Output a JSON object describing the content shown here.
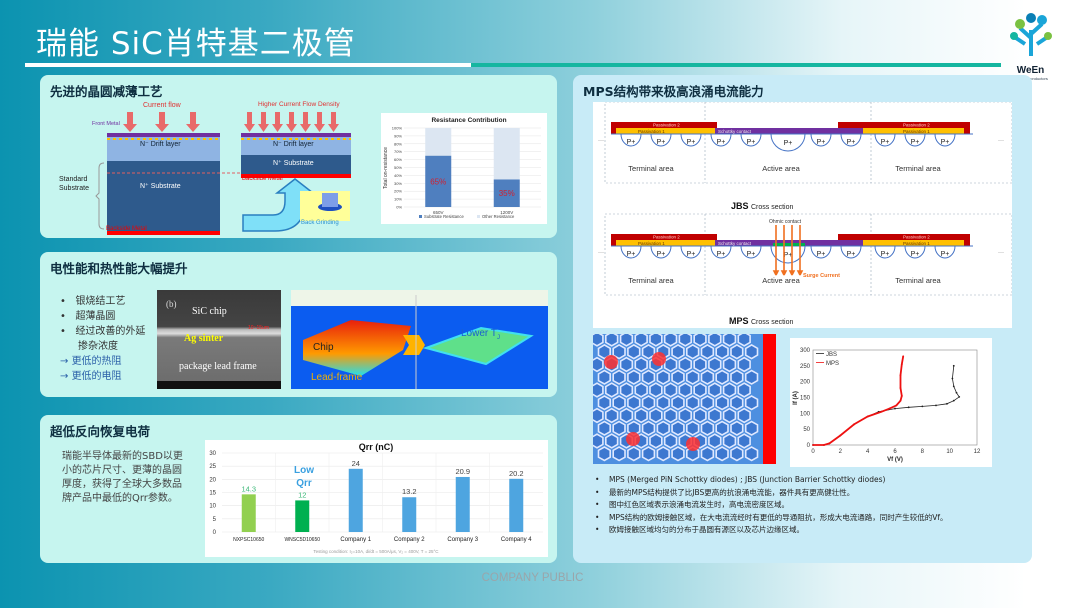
{
  "header": {
    "title": "瑞能 SiC肖特基二极管",
    "logo_text": "WeEn",
    "logo_sub": "En Semiconductors"
  },
  "panels": {
    "wafer": {
      "title": "先进的晶圆减薄工艺",
      "left_diagram": {
        "current_flow": "Current flow",
        "front_metal": "Front Metal",
        "drift": "N⁻ Drift layer",
        "substrate": "N⁺ Substrate",
        "backside": "Backside Metal",
        "standard": "Standard",
        "substrate_label": "Substrate"
      },
      "right_diagram": {
        "higher": "Higher Current Flow Density",
        "drift": "N⁻ Drift layer",
        "substrate": "N⁺ Substrate",
        "backside": "Backside Metal",
        "grinding": "Back Grinding"
      }
    },
    "performance": {
      "title": "电性能和热性能大幅提升",
      "bullets": [
        "银烧结工艺",
        "超薄晶圆",
        "经过改善的外延",
        "掺杂浓度"
      ],
      "arrows": [
        "更低的热阻",
        "更低的电阻"
      ],
      "sem": {
        "tag": "(b)",
        "chip": "SiC chip",
        "thickness": "10~15um",
        "sinter": "Ag sinter",
        "frame": "package lead frame"
      },
      "thermal": {
        "chip": "Chip",
        "frame": "Lead-frame",
        "lower": "Lower T",
        "lower_sub": "J"
      }
    },
    "qrr": {
      "title": "超低反向恢复电荷",
      "text": "瑞能半导体最新的SBD以更小的芯片尺寸、更薄的晶圆厚度，获得了全球大多数品牌产品中最低的Qrr参数。",
      "annotation": "Low Qrr",
      "condition": "Testing condition: I₂=10A, di/dt = 500A/μs, V₂ = 400V, T = 25°C"
    },
    "mps": {
      "title": "MPS结构带来极高浪涌电流能力",
      "cross": {
        "passivation2": "Passivation 2",
        "passivation1": "Passivation 1",
        "schottky": "Schottky contact",
        "pplus": "P+",
        "terminal": "Terminal area",
        "active": "Active area",
        "ohmic": "Ohmic contact",
        "surge": "Surge Current",
        "dots": "···"
      },
      "jbs_caption": {
        "bold": "JBS",
        "rest": "Cross section"
      },
      "mps_caption": {
        "bold": "MPS",
        "rest": "Cross section"
      },
      "bullets": [
        "MPS (Merged PiN Schottky diodes) ; JBS (Junction Barrier Schottky diodes)",
        "最新的MPS结构提供了比JBS更高的抗浪涌电流能，器件具有更高健壮性。",
        "图中红色区域表示浪涌电流发生时，高电流密度区域。",
        "MPS结构的欧姆接触区域，在大电流流经时有更低的导通阻抗，形成大电流通路，同时产生较低的Vf。",
        "欧姆接触区域均匀的分布于晶圆有源区以及芯片边缘区域。"
      ]
    }
  },
  "footer": {
    "label": "COMPANY PUBLIC"
  },
  "chart_data": [
    {
      "type": "bar",
      "stacked": true,
      "title": "Resistance Contribution",
      "ylabel": "Total on-resistance",
      "categories": [
        "650V",
        "1200V"
      ],
      "yticks": [
        "0%",
        "10%",
        "20%",
        "30%",
        "40%",
        "50%",
        "60%",
        "70%",
        "80%",
        "90%",
        "100%"
      ],
      "ylim": [
        0,
        100
      ],
      "series": [
        {
          "name": "Substrate Resistance",
          "values": [
            65,
            35
          ],
          "labels": [
            "65%",
            "35%"
          ],
          "color": "#4f7fbf"
        },
        {
          "name": "Other Resistance",
          "values": [
            35,
            65
          ],
          "color": "#dce6f2"
        }
      ],
      "legend": "bottom"
    },
    {
      "type": "bar",
      "title": "Qrr (nC)",
      "categories": [
        "NXPSC10650",
        "WNSC5D10650",
        "Company 1",
        "Company 2",
        "Company 3",
        "Company 4"
      ],
      "values": [
        14.3,
        12,
        24,
        13.2,
        20.9,
        20.2
      ],
      "labels": [
        "14.3",
        "12",
        "24",
        "13.2",
        "20.9",
        "20.2"
      ],
      "colors": [
        "#92d050",
        "#00b050",
        "#4ea5e0",
        "#4ea5e0",
        "#4ea5e0",
        "#4ea5e0"
      ],
      "yticks": [
        "0",
        "5",
        "10",
        "15",
        "20",
        "25",
        "30"
      ],
      "ylim": [
        0,
        30
      ],
      "grid": true
    },
    {
      "type": "line",
      "xlabel": "Vf (V)",
      "ylabel": "If (A)",
      "xlim": [
        0,
        12
      ],
      "ylim": [
        0,
        300
      ],
      "xticks": [
        "0",
        "2",
        "4",
        "6",
        "8",
        "10",
        "12"
      ],
      "yticks": [
        "0",
        "50",
        "100",
        "150",
        "200",
        "250",
        "300"
      ],
      "legend": "top-left",
      "series": [
        {
          "name": "JBS",
          "color": "#222222",
          "x": [
            0,
            0.8,
            1.2,
            2,
            3,
            4,
            4.8,
            6,
            7,
            8,
            9,
            9.8,
            10.3,
            10.7,
            10.5,
            10.3,
            10.2,
            10.3
          ],
          "y": [
            0,
            0,
            5,
            30,
            65,
            90,
            105,
            115,
            119,
            122,
            125,
            130,
            140,
            152,
            165,
            185,
            210,
            250
          ]
        },
        {
          "name": "MPS",
          "color": "#ee1111",
          "x": [
            0,
            0.8,
            1.2,
            2,
            3,
            4,
            5,
            5.6,
            6.1,
            6.4,
            6.5,
            6.4,
            6.4,
            6.5,
            6.6
          ],
          "y": [
            0,
            0,
            5,
            30,
            65,
            90,
            105,
            115,
            125,
            140,
            155,
            180,
            220,
            255,
            280
          ]
        }
      ]
    }
  ]
}
